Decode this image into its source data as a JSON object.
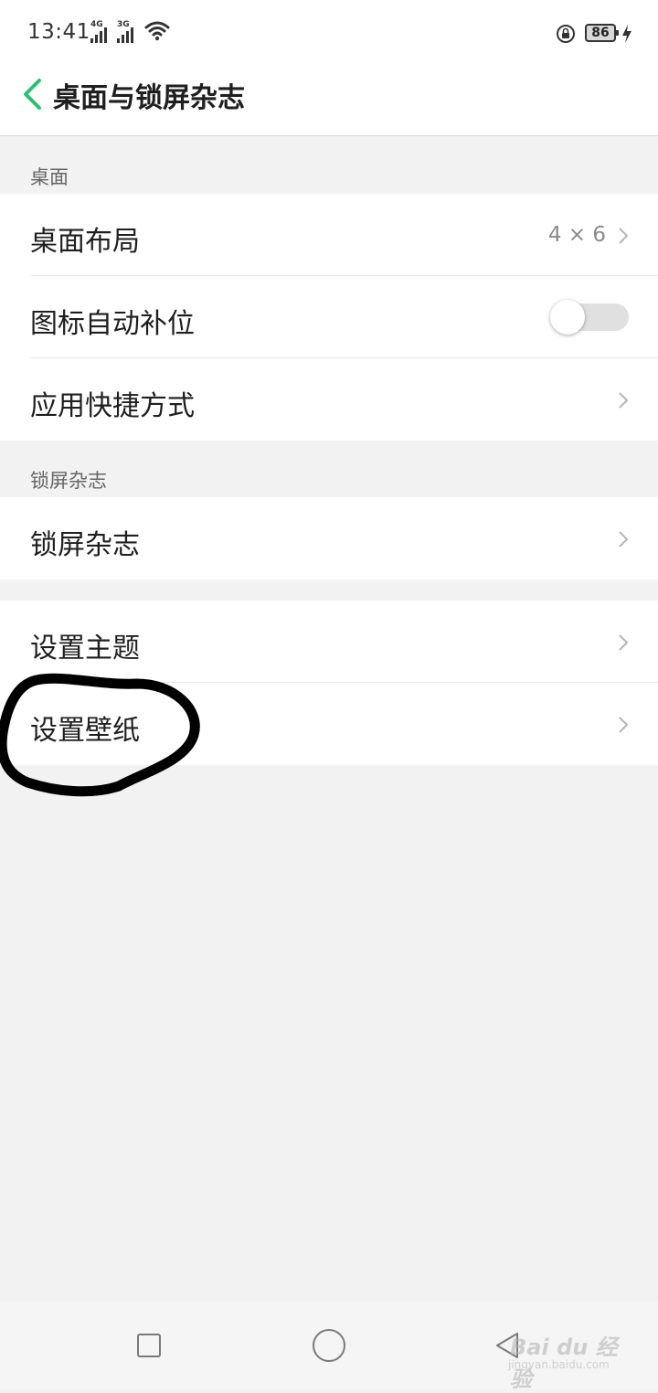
{
  "status_bar": {
    "time": "13:41",
    "signal_1_label": "4G",
    "signal_2_label": "3G",
    "battery_level": "86",
    "icons": [
      "signal-icon",
      "wifi-icon",
      "rotation-lock-icon",
      "battery-icon",
      "charging-icon"
    ]
  },
  "header": {
    "title": "桌面与锁屏杂志",
    "back_icon": "chevron-left-icon",
    "accent_color": "#2fbf71"
  },
  "sections": {
    "desktop": {
      "header": "桌面",
      "items": [
        {
          "label": "桌面布局",
          "value": "4 × 6"
        },
        {
          "label": "图标自动补位",
          "toggle": false
        },
        {
          "label": "应用快捷方式"
        }
      ]
    },
    "lockscreen": {
      "header": "锁屏杂志",
      "items": [
        {
          "label": "锁屏杂志"
        }
      ]
    },
    "theme": {
      "items": [
        {
          "label": "设置主题"
        },
        {
          "label": "设置壁纸"
        }
      ]
    }
  },
  "watermark": {
    "brand": "Bai du 经验",
    "url": "jingyan.baidu.com"
  }
}
